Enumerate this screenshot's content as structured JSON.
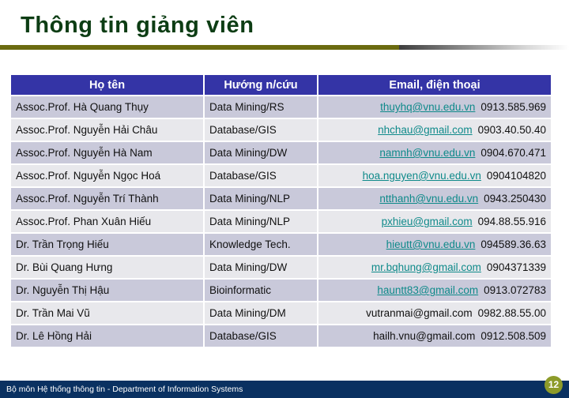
{
  "slide": {
    "title": "Thông tin giảng viên",
    "accent_title_color": "#0d3d14",
    "accent_rule_color": "#6b6b10",
    "header_bg_color": "#3434a6",
    "row_odd_color": "#c9c9da",
    "row_even_color": "#e8e8ec",
    "link_color": "#0f8a8a"
  },
  "table": {
    "columns": [
      {
        "key": "name",
        "label": "Họ tên"
      },
      {
        "key": "field",
        "label": "Hướng n/cứu"
      },
      {
        "key": "mail",
        "label": "Email, điện thoại"
      }
    ],
    "rows": [
      {
        "name": "Assoc.Prof. Hà Quang Thụy",
        "field": "Data Mining/RS",
        "email": "thuyhq@vnu.edu.vn",
        "phone": "0913.585.969",
        "email_is_link": true
      },
      {
        "name": "Assoc.Prof. Nguyễn Hải Châu",
        "field": "Database/GIS",
        "email": "nhchau@gmail.com",
        "phone": "0903.40.50.40",
        "email_is_link": true
      },
      {
        "name": "Assoc.Prof. Nguyễn Hà Nam",
        "field": "Data Mining/DW",
        "email": "namnh@vnu.edu.vn",
        "phone": "0904.670.471",
        "email_is_link": true
      },
      {
        "name": "Assoc.Prof. Nguyễn Ngọc Hoá",
        "field": "Database/GIS",
        "email": "hoa.nguyen@vnu.edu.vn",
        "phone": "0904104820",
        "email_is_link": true
      },
      {
        "name": "Assoc.Prof. Nguyễn Trí Thành",
        "field": "Data Mining/NLP",
        "email": "ntthanh@vnu.edu.vn",
        "phone": "0943.250430",
        "email_is_link": true
      },
      {
        "name": "Assoc.Prof. Phan Xuân Hiếu",
        "field": "Data Mining/NLP",
        "email": "pxhieu@gmail.com",
        "phone": "094.88.55.916",
        "email_is_link": true
      },
      {
        "name": "Dr. Trần Trọng Hiếu",
        "field": "Knowledge Tech.",
        "email": "hieutt@vnu.edu.vn",
        "phone": "094589.36.63",
        "email_is_link": true
      },
      {
        "name": "Dr. Bùi Quang Hưng",
        "field": "Data Mining/DW",
        "email": "mr.bqhung@gmail.com",
        "phone": "0904371339",
        "email_is_link": true
      },
      {
        "name": "Dr. Nguyễn Thị Hậu",
        "field": "Bioinformatic",
        "email": "hauntt83@gmail.com",
        "phone": "0913.072783",
        "email_is_link": true
      },
      {
        "name": "Dr. Trần Mai Vũ",
        "field": "Data Mining/DM",
        "email": "vutranmai@gmail.com",
        "phone": "0982.88.55.00",
        "email_is_link": false
      },
      {
        "name": "Dr. Lê Hồng Hải",
        "field": "Database/GIS",
        "email": "hailh.vnu@gmail.com",
        "phone": "0912.508.509",
        "email_is_link": false
      }
    ]
  },
  "footer": {
    "text": "Bộ môn Hệ thống thông tin - Department of Information Systems",
    "slide_number": "12",
    "bar_color": "#0a3161",
    "badge_color": "#8d9b2a"
  }
}
